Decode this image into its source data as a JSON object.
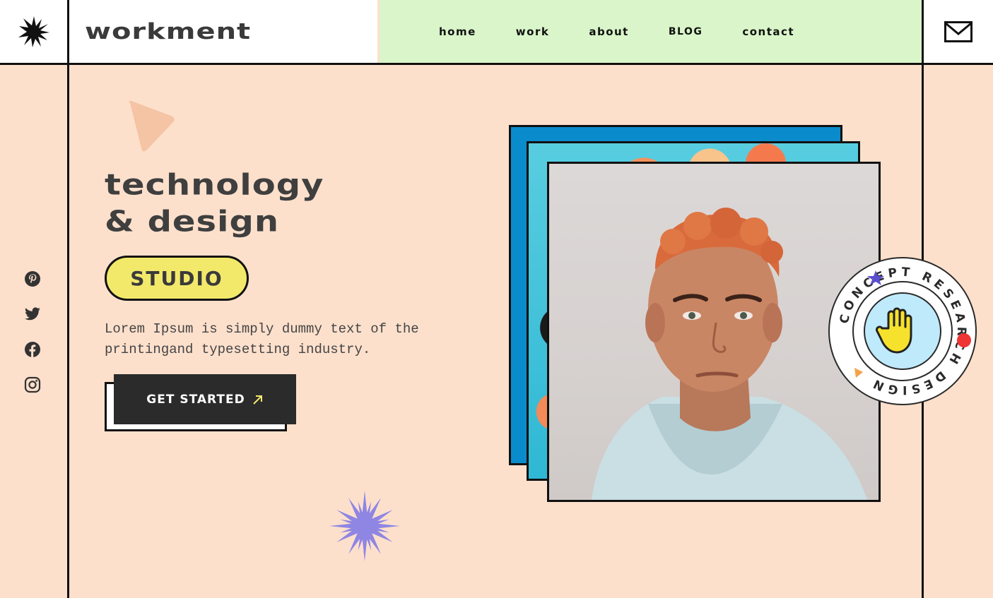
{
  "header": {
    "brand": "workment",
    "nav": [
      {
        "label": "Home"
      },
      {
        "label": "work"
      },
      {
        "label": "about"
      },
      {
        "label": "BLOG"
      },
      {
        "label": "contact"
      }
    ]
  },
  "hero": {
    "headline_line1": "technology",
    "headline_line2": "& design",
    "pill": "STUDIO",
    "description_line1": "Lorem Ipsum is simply dummy text of the",
    "description_line2": "printingand typesetting industry.",
    "cta_label": "GET STARTED"
  },
  "badge": {
    "ring_text": "CONCEPT RESEARCH DESIGN"
  },
  "social": [
    "pinterest-icon",
    "twitter-icon",
    "facebook-icon",
    "instagram-icon"
  ],
  "colors": {
    "background": "#fde0cc",
    "nav_background": "#d9f5c9",
    "pill": "#f2e96b",
    "button": "#2b2b2b",
    "accent_purple": "#8f86e3",
    "photo_frame_blue": "#0a8ccc"
  }
}
